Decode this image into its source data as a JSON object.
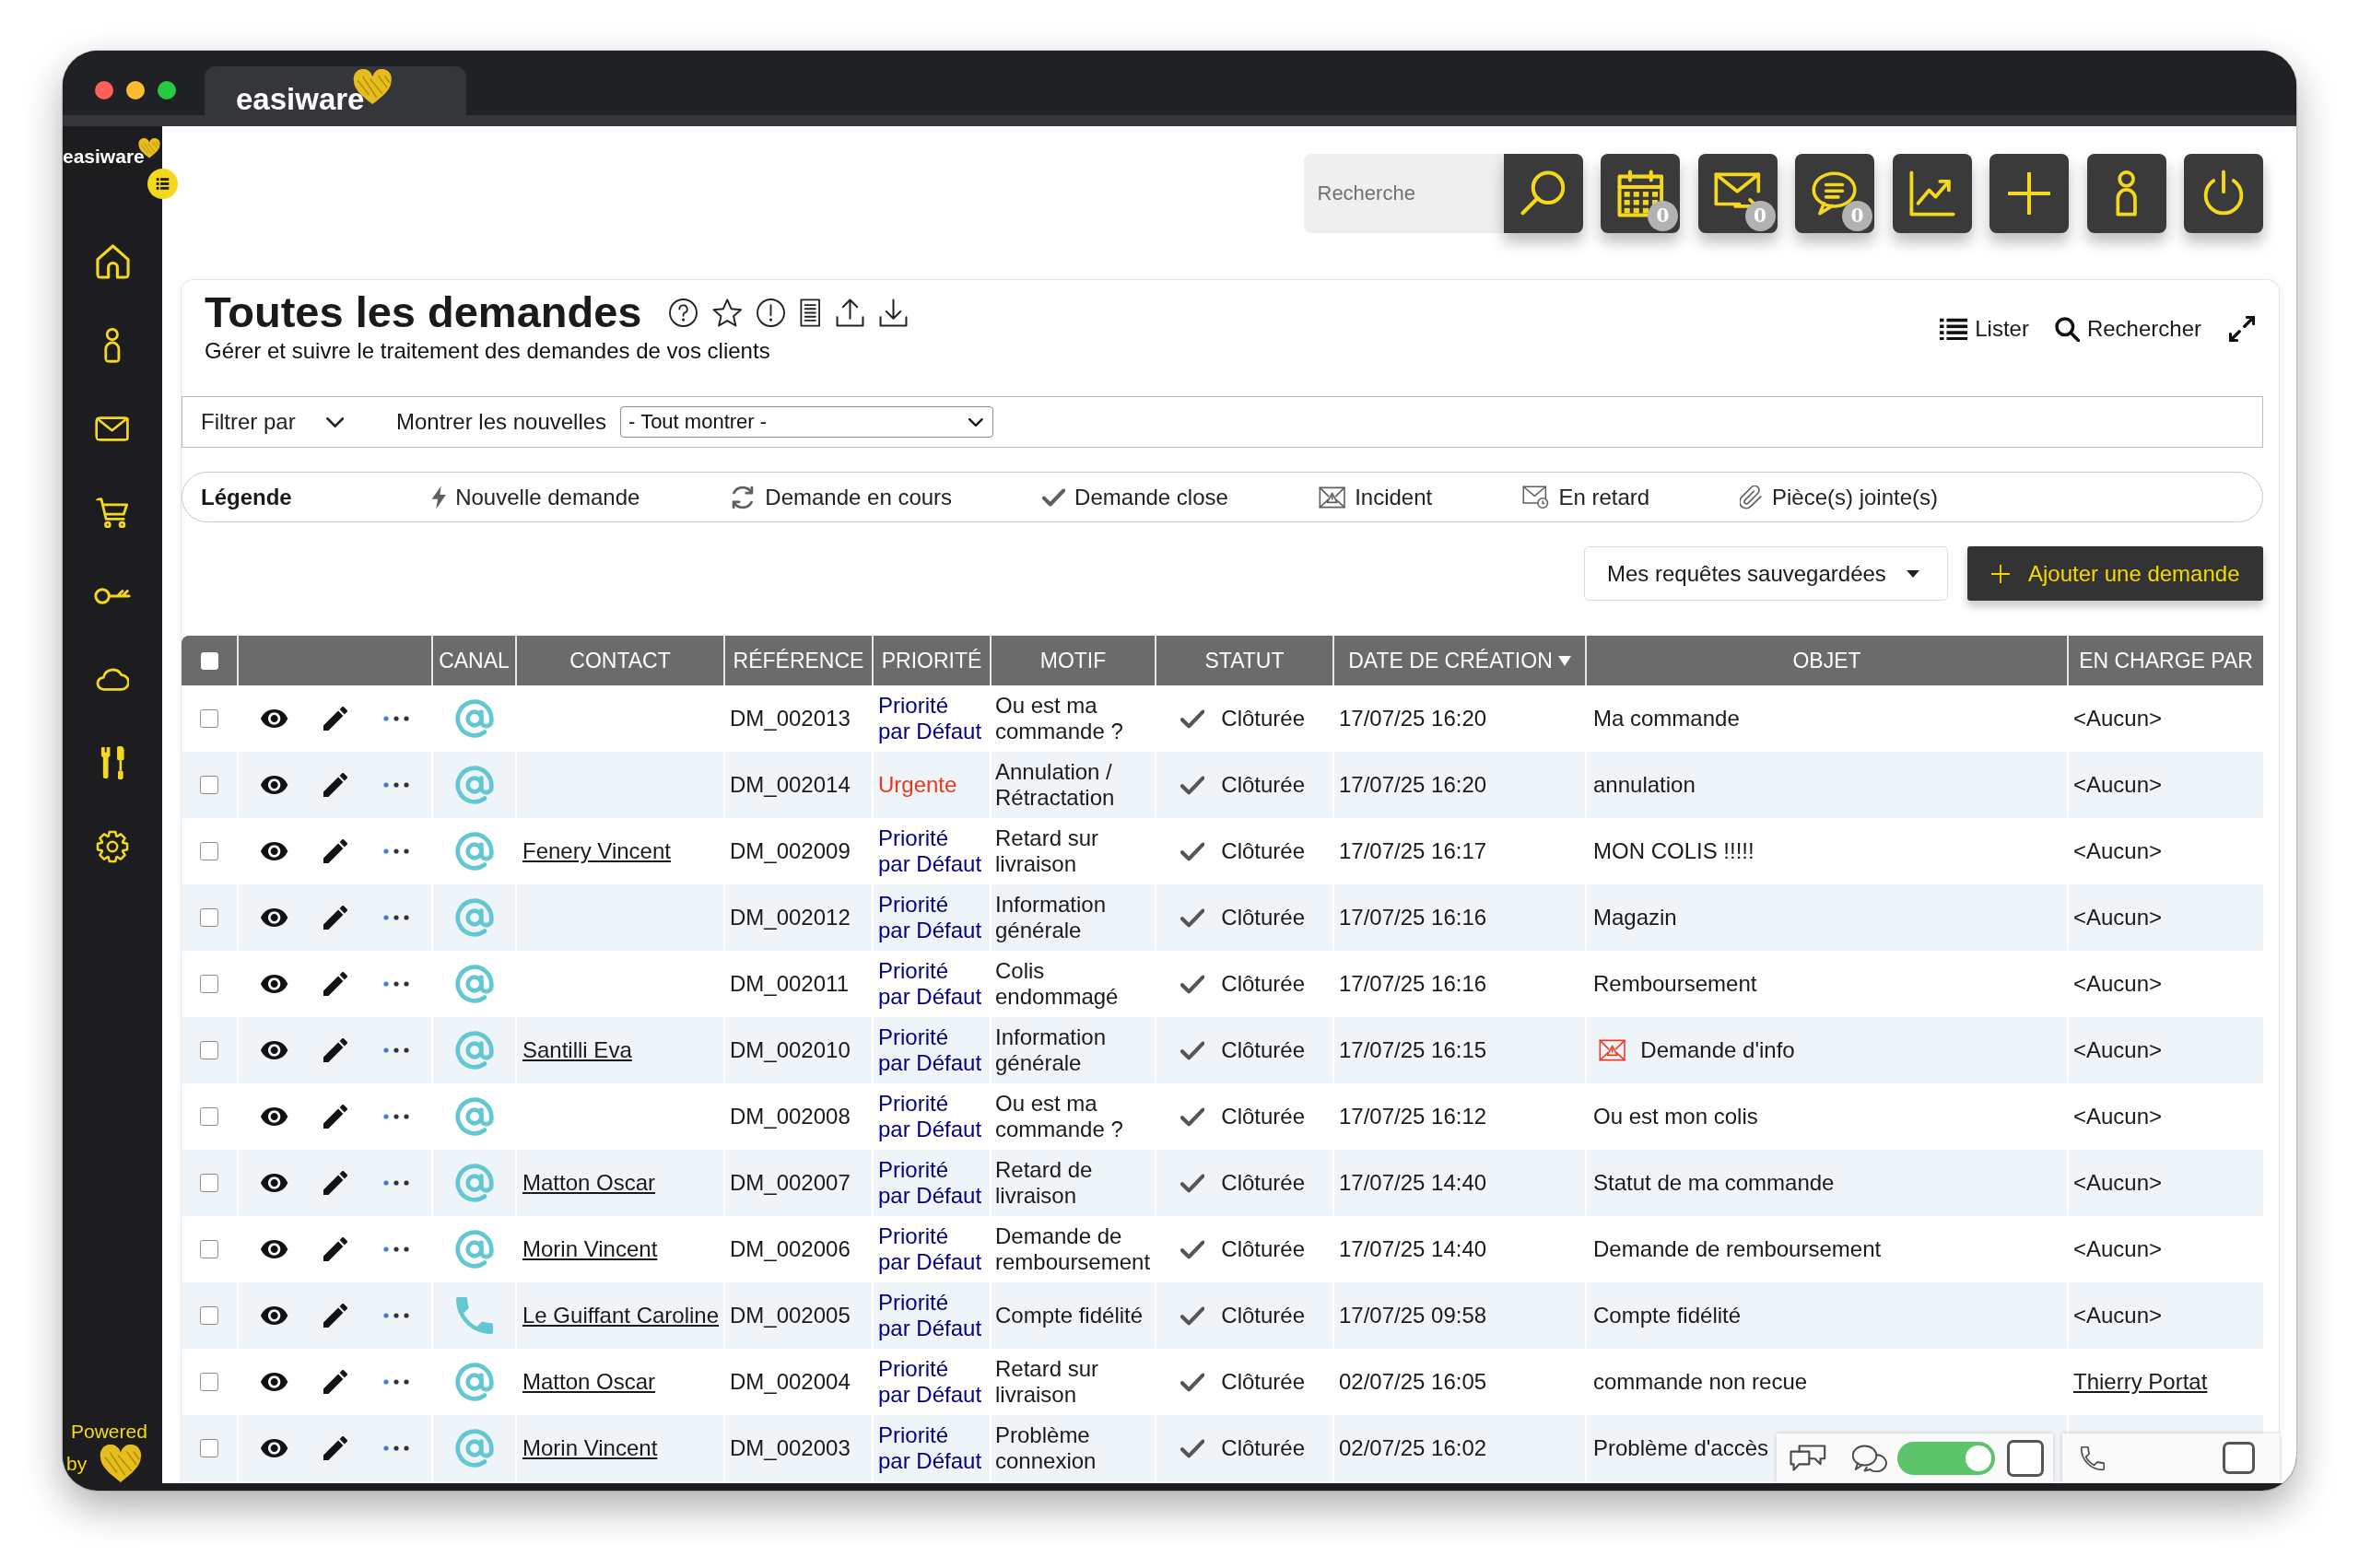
{
  "window": {
    "tab": "easiware"
  },
  "sidebar": {
    "logo": "easiware",
    "items": [
      {
        "kind": "home",
        "selected": false
      },
      {
        "kind": "contact",
        "selected": false
      },
      {
        "kind": "mail",
        "selected": false
      },
      {
        "kind": "cart",
        "selected": false
      },
      {
        "kind": "key",
        "selected": false
      },
      {
        "kind": "cloud",
        "selected": false
      },
      {
        "kind": "tools",
        "selected": false
      },
      {
        "kind": "settings",
        "selected": false
      }
    ],
    "powered": "Powered",
    "by": "by"
  },
  "toolbar": {
    "search": {
      "placeholder": "Recherche"
    },
    "buttons": [
      {
        "kind": "calendar",
        "badge": "0"
      },
      {
        "kind": "mail",
        "badge": "0"
      },
      {
        "kind": "chat",
        "badge": "0"
      },
      {
        "kind": "stats"
      },
      {
        "kind": "add"
      },
      {
        "kind": "account"
      },
      {
        "kind": "logout"
      }
    ]
  },
  "page": {
    "title": "Toutes les demandes",
    "subtitle": "Gérer et suivre le traitement des demandes de vos clients",
    "links": [
      {
        "kind": "list",
        "label": "Lister"
      },
      {
        "kind": "search",
        "label": "Rechercher"
      }
    ]
  },
  "filters": {
    "toggle": "Filtrer par",
    "show_new_label": "Montrer les nouvelles",
    "show_new_value": "- Tout montrer -"
  },
  "legend": {
    "title": "Légende",
    "items": [
      {
        "kind": "new",
        "label": "Nouvelle demande"
      },
      {
        "kind": "in_progress",
        "label": "Demande en cours"
      },
      {
        "kind": "closed",
        "label": "Demande close"
      },
      {
        "kind": "incident",
        "label": "Incident"
      },
      {
        "kind": "late",
        "label": "En retard"
      },
      {
        "kind": "attachment",
        "label": "Pièce(s) jointe(s)"
      }
    ]
  },
  "actions": {
    "saved_queries": "Mes requêtes sauvegardées",
    "add": "Ajouter une demande"
  },
  "table": {
    "columns": [
      {
        "kind": "checkbox",
        "checked": false
      },
      {
        "kind": "actions"
      },
      {
        "kind": "text",
        "label": "CANAL",
        "sorted": false
      },
      {
        "kind": "text",
        "label": "CONTACT",
        "sorted": false
      },
      {
        "kind": "text",
        "label": "RÉFÉRENCE",
        "sorted": false
      },
      {
        "kind": "text",
        "label": "PRIORITÉ",
        "sorted": false
      },
      {
        "kind": "text",
        "label": "MOTIF",
        "sorted": false
      },
      {
        "kind": "text",
        "label": "STATUT",
        "sorted": false
      },
      {
        "kind": "text",
        "label": "DATE DE CRÉATION",
        "sorted": true
      },
      {
        "kind": "text",
        "label": "OBJET",
        "sorted": false
      },
      {
        "kind": "text",
        "label": "EN CHARGE PAR",
        "sorted": false
      }
    ],
    "rows": [
      {
        "checked": false,
        "channel": {
          "kind": "email"
        },
        "reference": "DM_002013",
        "priority": {
          "text": "Priorité par Défaut",
          "color": "#000080"
        },
        "reason": "Ou est ma commande ?",
        "status": {
          "kind": "closed",
          "text": "Clôturée"
        },
        "created": "17/07/25 16:20",
        "subject": "Ma commande",
        "assignee": {
          "kind": "plain",
          "text": "<Aucun>"
        }
      },
      {
        "checked": false,
        "channel": {
          "kind": "email"
        },
        "reference": "DM_002014",
        "priority": {
          "text": "Urgente",
          "color": "#e8381e"
        },
        "reason": "Annulation / Rétractation",
        "status": {
          "kind": "closed",
          "text": "Clôturée"
        },
        "created": "17/07/25 16:20",
        "subject": "annulation",
        "assignee": {
          "kind": "plain",
          "text": "<Aucun>"
        }
      },
      {
        "checked": false,
        "channel": {
          "kind": "email"
        },
        "contact": "Fenery Vincent",
        "reference": "DM_002009",
        "priority": {
          "text": "Priorité par Défaut",
          "color": "#000080"
        },
        "reason": "Retard sur livraison",
        "status": {
          "kind": "closed",
          "text": "Clôturée"
        },
        "created": "17/07/25 16:17",
        "subject": "MON COLIS !!!!!",
        "assignee": {
          "kind": "plain",
          "text": "<Aucun>"
        }
      },
      {
        "checked": false,
        "channel": {
          "kind": "email"
        },
        "reference": "DM_002012",
        "priority": {
          "text": "Priorité par Défaut",
          "color": "#000080"
        },
        "reason": "Information générale",
        "status": {
          "kind": "closed",
          "text": "Clôturée"
        },
        "created": "17/07/25 16:16",
        "subject": "Magazin",
        "assignee": {
          "kind": "plain",
          "text": "<Aucun>"
        }
      },
      {
        "checked": false,
        "channel": {
          "kind": "email"
        },
        "reference": "DM_002011",
        "priority": {
          "text": "Priorité par Défaut",
          "color": "#000080"
        },
        "reason": "Colis endommagé",
        "status": {
          "kind": "closed",
          "text": "Clôturée"
        },
        "created": "17/07/25 16:16",
        "subject": "Remboursement",
        "assignee": {
          "kind": "plain",
          "text": "<Aucun>"
        }
      },
      {
        "checked": false,
        "channel": {
          "kind": "email"
        },
        "contact": "Santilli Eva",
        "reference": "DM_002010",
        "priority": {
          "text": "Priorité par Défaut",
          "color": "#000080"
        },
        "reason": "Information générale",
        "status": {
          "kind": "closed",
          "text": "Clôturée"
        },
        "created": "17/07/25 16:15",
        "flag": {
          "kind": "incident"
        },
        "subject": "Demande d'info",
        "assignee": {
          "kind": "plain",
          "text": "<Aucun>"
        }
      },
      {
        "checked": false,
        "channel": {
          "kind": "email"
        },
        "reference": "DM_002008",
        "priority": {
          "text": "Priorité par Défaut",
          "color": "#000080"
        },
        "reason": "Ou est ma commande ?",
        "status": {
          "kind": "closed",
          "text": "Clôturée"
        },
        "created": "17/07/25 16:12",
        "subject": "Ou est mon colis",
        "assignee": {
          "kind": "plain",
          "text": "<Aucun>"
        }
      },
      {
        "checked": false,
        "channel": {
          "kind": "email"
        },
        "contact": "Matton Oscar",
        "reference": "DM_002007",
        "priority": {
          "text": "Priorité par Défaut",
          "color": "#000080"
        },
        "reason": "Retard de livraison",
        "status": {
          "kind": "closed",
          "text": "Clôturée"
        },
        "created": "17/07/25 14:40",
        "subject": "Statut de ma commande",
        "assignee": {
          "kind": "plain",
          "text": "<Aucun>"
        }
      },
      {
        "checked": false,
        "channel": {
          "kind": "email"
        },
        "contact": "Morin Vincent",
        "reference": "DM_002006",
        "priority": {
          "text": "Priorité par Défaut",
          "color": "#000080"
        },
        "reason": "Demande de remboursement",
        "status": {
          "kind": "closed",
          "text": "Clôturée"
        },
        "created": "17/07/25 14:40",
        "subject": "Demande de remboursement",
        "assignee": {
          "kind": "plain",
          "text": "<Aucun>"
        }
      },
      {
        "checked": false,
        "channel": {
          "kind": "phone"
        },
        "contact": "Le Guiffant Caroline",
        "reference": "DM_002005",
        "priority": {
          "text": "Priorité par Défaut",
          "color": "#000080"
        },
        "reason": "Compte fidélité",
        "status": {
          "kind": "closed",
          "text": "Clôturée"
        },
        "created": "17/07/25 09:58",
        "subject": "Compte fidélité",
        "assignee": {
          "kind": "plain",
          "text": "<Aucun>"
        }
      },
      {
        "checked": false,
        "channel": {
          "kind": "email"
        },
        "contact": "Matton Oscar",
        "reference": "DM_002004",
        "priority": {
          "text": "Priorité par Défaut",
          "color": "#000080"
        },
        "reason": "Retard sur livraison",
        "status": {
          "kind": "closed",
          "text": "Clôturée"
        },
        "created": "02/07/25 16:05",
        "subject": "commande non recue",
        "assignee": {
          "kind": "link",
          "text": "Thierry Portat"
        }
      },
      {
        "checked": false,
        "channel": {
          "kind": "email"
        },
        "contact": "Morin Vincent",
        "reference": "DM_002003",
        "priority": {
          "text": "Priorité par Défaut",
          "color": "#000080"
        },
        "reason": "Problème connexion",
        "status": {
          "kind": "closed",
          "text": "Clôturée"
        },
        "created": "02/07/25 16:02",
        "subject": "Problème d'accès"
      }
    ]
  },
  "softphone": {
    "chat_toggle": {
      "on": true
    },
    "chat_box": {
      "checked": false
    },
    "phone_box": {
      "checked": false
    }
  }
}
